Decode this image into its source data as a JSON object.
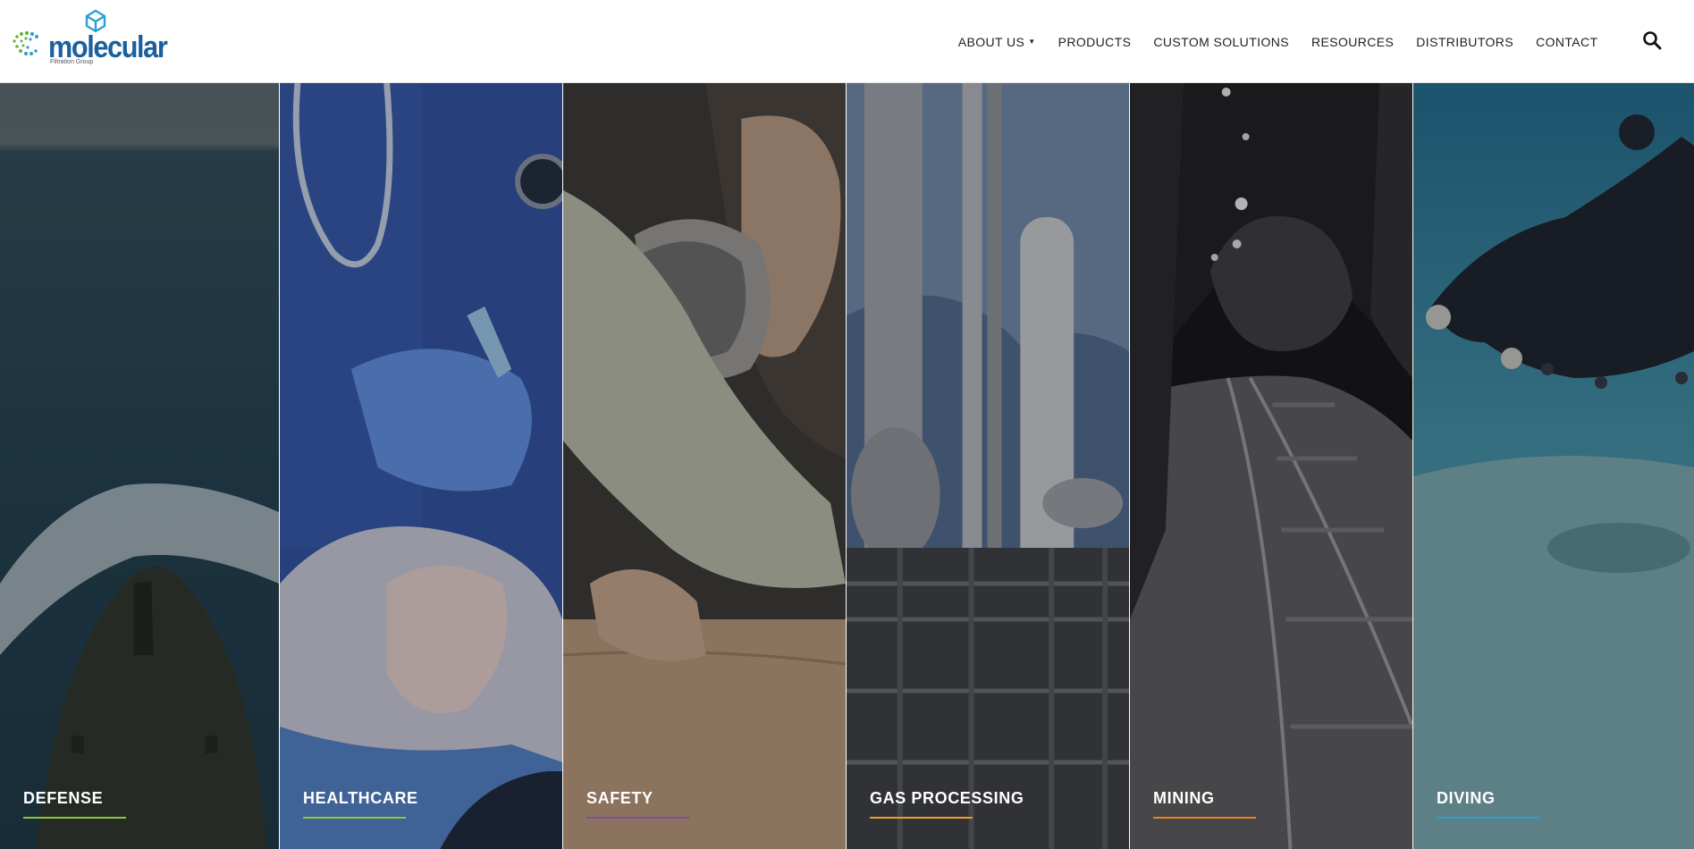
{
  "brand": {
    "name": "molecular",
    "tagline": "Filtration Group",
    "colors": {
      "wordmark": "#1b5f9e",
      "accent": "#2a9fd6",
      "swirl_green": "#63b33e"
    }
  },
  "nav": {
    "items": [
      {
        "label": "ABOUT US",
        "has_dropdown": true
      },
      {
        "label": "PRODUCTS",
        "has_dropdown": false
      },
      {
        "label": "CUSTOM SOLUTIONS",
        "has_dropdown": false
      },
      {
        "label": "RESOURCES",
        "has_dropdown": false
      },
      {
        "label": "DISTRIBUTORS",
        "has_dropdown": false
      },
      {
        "label": "CONTACT",
        "has_dropdown": false
      }
    ],
    "search_icon": "search-icon"
  },
  "panels": [
    {
      "label": "DEFENSE",
      "underline_color": "#8dc63f"
    },
    {
      "label": "HEALTHCARE",
      "underline_color": "#8dc63f"
    },
    {
      "label": "SAFETY",
      "underline_color": "#7b4fa0"
    },
    {
      "label": "GAS PROCESSING",
      "underline_color": "#f39c2c"
    },
    {
      "label": "MINING",
      "underline_color": "#ef7d22"
    },
    {
      "label": "DIVING",
      "underline_color": "#2a9fd6"
    }
  ]
}
